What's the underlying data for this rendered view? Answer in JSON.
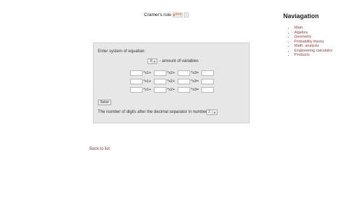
{
  "header": {
    "title": "Cramer's rule",
    "rss_label": "RSS",
    "small_button_label": "+"
  },
  "form": {
    "instruction": "Enter system of equation:",
    "variables_count": "3",
    "variables_label": "- amount of variables",
    "rows": [
      {
        "labels": [
          "*x1+",
          "*x2+",
          "*x3="
        ]
      },
      {
        "labels": [
          "*x1+",
          "*x2+",
          "*x3="
        ]
      },
      {
        "labels": [
          "*x1+",
          "*x2+",
          "*x3="
        ]
      }
    ],
    "solve_label": "Solve",
    "digits_label": "The number of digits after the decimal separator in numbers:",
    "digits_value": "2"
  },
  "back_link": "Back to list",
  "navigation": {
    "title": "Naviagation",
    "items": [
      {
        "label": "Main"
      },
      {
        "label": "Algebra"
      },
      {
        "label": "Geometry"
      },
      {
        "label": "Probability theory"
      },
      {
        "label": "Math. analysis"
      },
      {
        "label": "Engineering calculator"
      },
      {
        "label": "Products"
      }
    ]
  },
  "colors": {
    "link": "#8a3a3a",
    "panel_background": "#e7e7e7",
    "rss_accent": "#f07020"
  }
}
